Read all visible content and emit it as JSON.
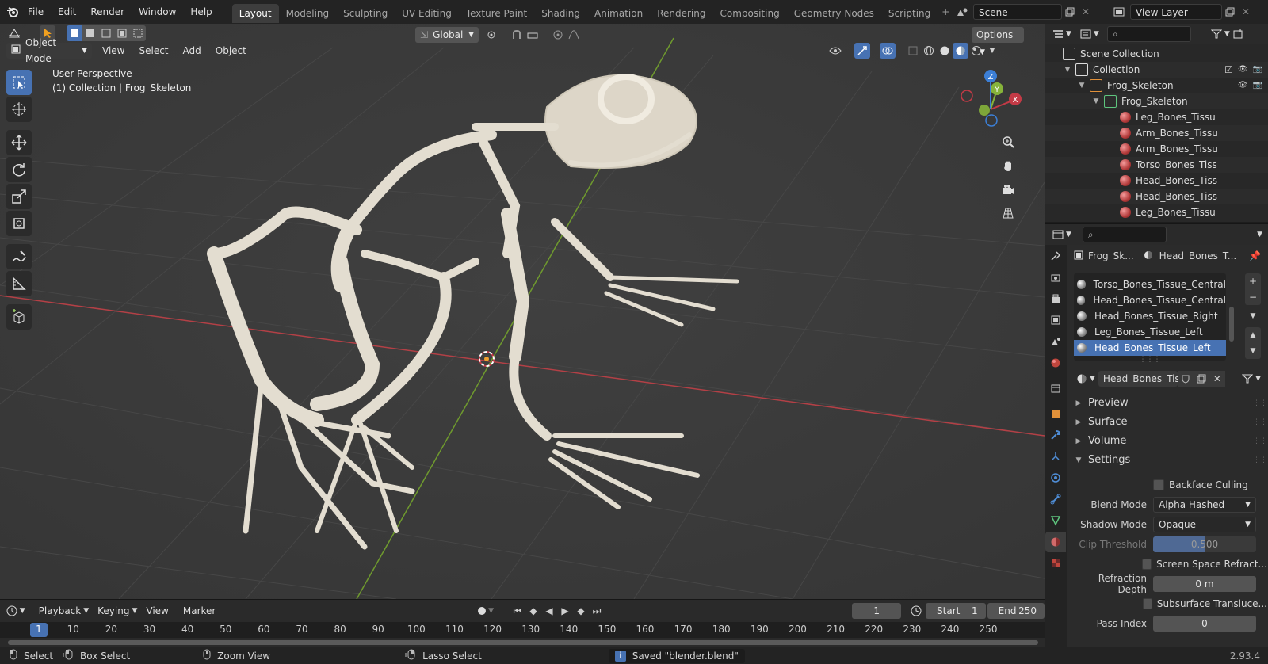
{
  "topbar": {
    "menus": [
      "File",
      "Edit",
      "Render",
      "Window",
      "Help"
    ],
    "workspaces": [
      "Layout",
      "Modeling",
      "Sculpting",
      "UV Editing",
      "Texture Paint",
      "Shading",
      "Animation",
      "Rendering",
      "Compositing",
      "Geometry Nodes",
      "Scripting"
    ],
    "active_workspace": "Layout",
    "scene": "Scene",
    "view_layer": "View Layer"
  },
  "viewport_header": {
    "transform_orientation": "Global",
    "options_label": "Options",
    "mode": "Object Mode",
    "menus": [
      "View",
      "Select",
      "Add",
      "Object"
    ]
  },
  "viewport": {
    "perspective_label": "User Perspective",
    "collection_label": "(1) Collection | Frog_Skeleton",
    "gizmo_axes": {
      "x": "X",
      "y": "Y",
      "z": "Z"
    }
  },
  "outliner": {
    "rows": [
      {
        "label": "Scene Collection",
        "icon": "scene-collection-icon"
      },
      {
        "label": "Collection",
        "icon": "collection-icon"
      },
      {
        "label": "Frog_Skeleton",
        "icon": "mesh-object-icon"
      },
      {
        "label": "Frog_Skeleton",
        "icon": "mesh-data-icon"
      },
      {
        "label": "Leg_Bones_Tissu",
        "icon": "material-icon"
      },
      {
        "label": "Arm_Bones_Tissu",
        "icon": "material-icon"
      },
      {
        "label": "Arm_Bones_Tissu",
        "icon": "material-icon"
      },
      {
        "label": "Torso_Bones_Tiss",
        "icon": "material-icon"
      },
      {
        "label": "Head_Bones_Tiss",
        "icon": "material-icon"
      },
      {
        "label": "Head_Bones_Tiss",
        "icon": "material-icon"
      },
      {
        "label": "Leg_Bones_Tissu",
        "icon": "material-icon"
      }
    ]
  },
  "properties": {
    "breadcrumb_object": "Frog_Sk...",
    "breadcrumb_material": "Head_Bones_T...",
    "material_slots": [
      "Torso_Bones_Tissue_Central",
      "Head_Bones_Tissue_Central",
      "Head_Bones_Tissue_Right",
      "Leg_Bones_Tissue_Left",
      "Head_Bones_Tissue_Left"
    ],
    "selected_slot": "Head_Bones_Tissue_Left",
    "material_name": "Head_Bones_Tis...",
    "panels": {
      "preview": "Preview",
      "surface": "Surface",
      "volume": "Volume",
      "settings": "Settings"
    },
    "settings": {
      "backface_culling": "Backface Culling",
      "blend_mode_label": "Blend Mode",
      "blend_mode": "Alpha Hashed",
      "shadow_mode_label": "Shadow Mode",
      "shadow_mode": "Opaque",
      "clip_threshold_label": "Clip Threshold",
      "clip_threshold": "0.500",
      "clip_threshold_fraction": 0.5,
      "screen_space_refraction": "Screen Space Refract...",
      "refraction_depth_label": "Refraction Depth",
      "refraction_depth": "0 m",
      "subsurface_translucency": "Subsurface Translucе...",
      "pass_index_label": "Pass Index",
      "pass_index": "0"
    }
  },
  "timeline": {
    "menus": [
      "Playback",
      "Keying",
      "View",
      "Marker"
    ],
    "current_frame": "1",
    "start_label": "Start",
    "start": "1",
    "end_label": "End",
    "end": "250",
    "ticks": [
      "1",
      "10",
      "20",
      "30",
      "40",
      "50",
      "60",
      "70",
      "80",
      "90",
      "100",
      "110",
      "120",
      "130",
      "140",
      "150",
      "160",
      "170",
      "180",
      "190",
      "200",
      "210",
      "220",
      "230",
      "240",
      "250"
    ]
  },
  "statusbar": {
    "select": "Select",
    "box_select": "Box Select",
    "zoom_view": "Zoom View",
    "lasso_select": "Lasso Select",
    "message": "Saved \"blender.blend\"",
    "version": "2.93.4"
  },
  "colors": {
    "accent": "#4772b3",
    "x_axis": "#c43a46",
    "y_axis": "#86b33a",
    "z_axis": "#3c7fd6",
    "bone": "#e3ddd0"
  }
}
